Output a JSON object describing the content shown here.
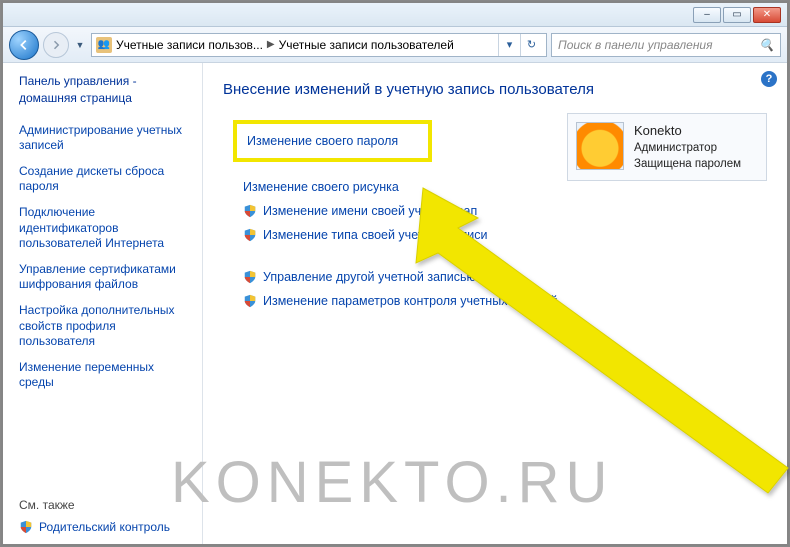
{
  "window": {
    "minimize": "–",
    "maximize": "▭",
    "close": "✕"
  },
  "nav": {
    "breadcrumb1": "Учетные записи пользов...",
    "breadcrumb2": "Учетные записи пользователей",
    "search_placeholder": "Поиск в панели управления"
  },
  "sidebar": {
    "home": "Панель управления - домашняя страница",
    "links": [
      "Администрирование учетных записей",
      "Создание дискеты сброса пароля",
      "Подключение идентификаторов пользователей Интернета",
      "Управление сертификатами шифрования файлов",
      "Настройка дополнительных свойств профиля пользователя",
      "Изменение переменных среды"
    ],
    "see_also": "См. также",
    "parental": "Родительский контроль"
  },
  "main": {
    "heading": "Внесение изменений в учетную запись пользователя",
    "tasks": {
      "change_password": "Изменение своего пароля",
      "change_picture": "Изменение своего рисунка",
      "change_name": "Изменение имени своей учетной зап",
      "change_type": "Изменение типа своей учетной записи",
      "manage_other": "Управление другой учетной записью",
      "uac_settings": "Изменение параметров контроля учетных записей"
    }
  },
  "user": {
    "name": "Konekto",
    "role": "Администратор",
    "status": "Защищена паролем"
  },
  "watermark": "KONEKTO.RU"
}
